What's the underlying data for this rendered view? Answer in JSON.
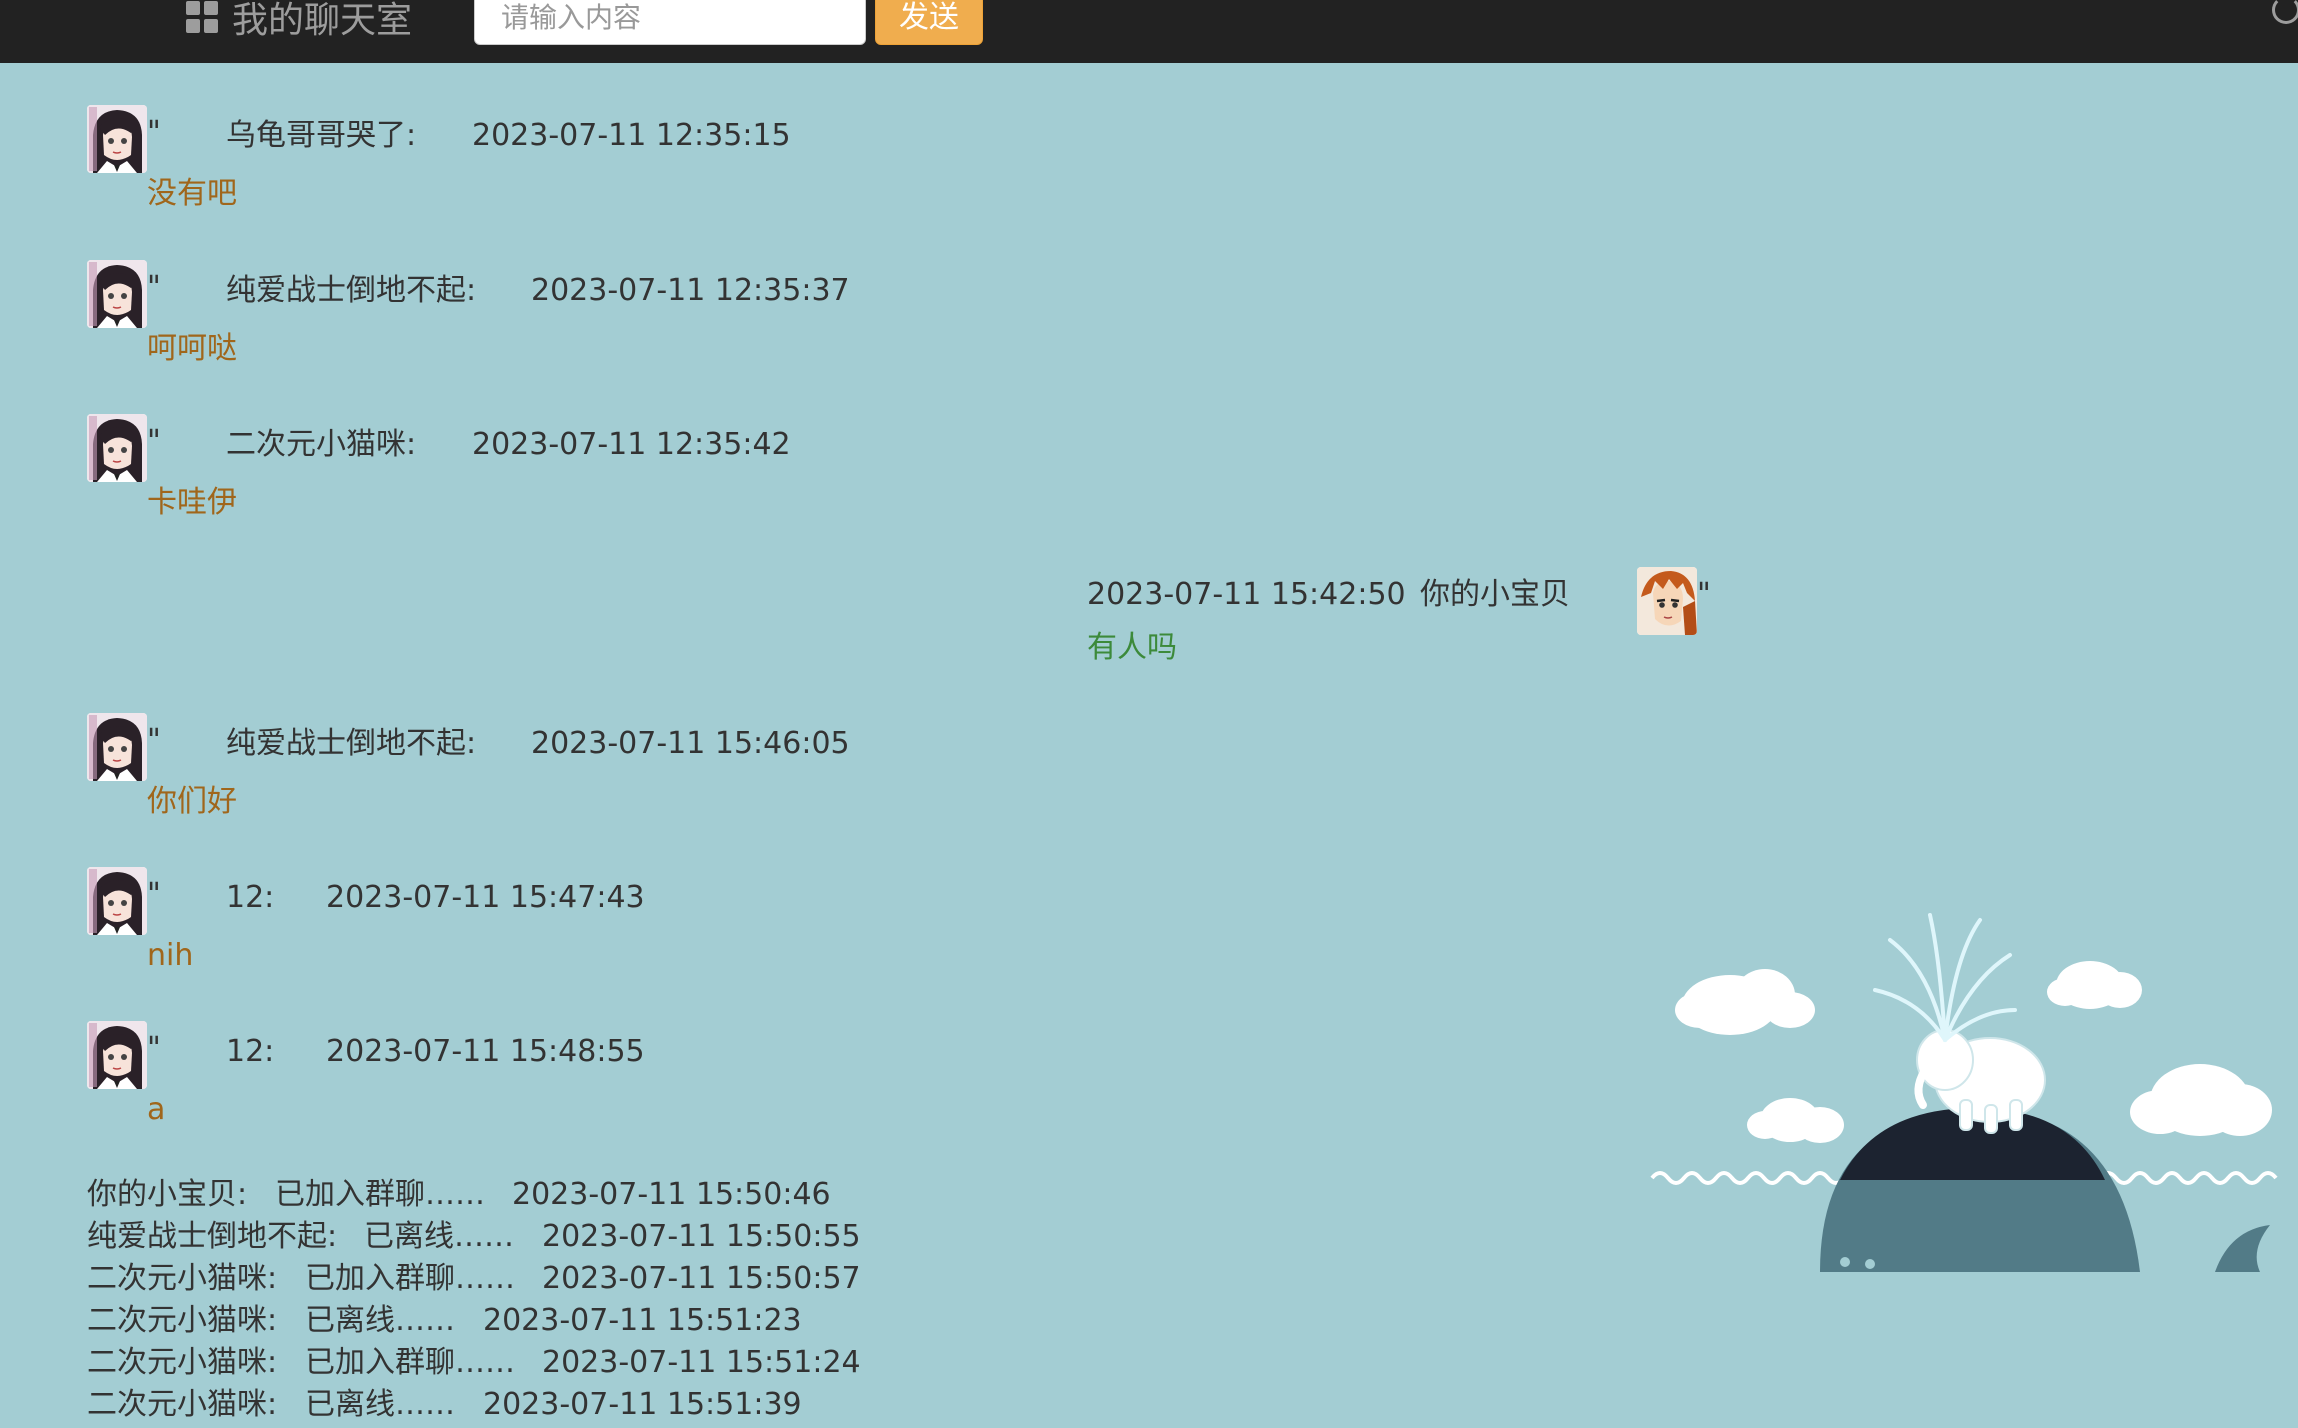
{
  "header": {
    "title": "我的聊天室",
    "input": {
      "placeholder": "请输入内容",
      "value": ""
    },
    "send_label": "发送"
  },
  "messages": [
    {
      "user": "乌龟哥哥哭了:",
      "time": "2023-07-11 12:35:15",
      "text": "没有吧",
      "self": false
    },
    {
      "user": "纯爱战士倒地不起:",
      "time": "2023-07-11 12:35:37",
      "text": "呵呵哒",
      "self": false
    },
    {
      "user": "二次元小猫咪:",
      "time": "2023-07-11 12:35:42",
      "text": "卡哇伊",
      "self": false
    },
    {
      "user": "你的小宝贝",
      "time": "2023-07-11 15:42:50",
      "text": "有人吗",
      "self": true
    },
    {
      "user": "纯爱战士倒地不起:",
      "time": "2023-07-11 15:46:05",
      "text": "你们好",
      "self": false
    },
    {
      "user": "12:",
      "time": "2023-07-11 15:47:43",
      "text": "nih",
      "self": false
    },
    {
      "user": "12:",
      "time": "2023-07-11 15:48:55",
      "text": "a",
      "self": false
    }
  ],
  "avatar_quote": "\"",
  "system_log": [
    {
      "user": "你的小宝贝:",
      "event": "已加入群聊……",
      "time": "2023-07-11 15:50:46"
    },
    {
      "user": "纯爱战士倒地不起:",
      "event": "已离线……",
      "time": "2023-07-11 15:50:55"
    },
    {
      "user": "二次元小猫咪:",
      "event": "已加入群聊……",
      "time": "2023-07-11 15:50:57"
    },
    {
      "user": "二次元小猫咪:",
      "event": "已离线……",
      "time": "2023-07-11 15:51:23"
    },
    {
      "user": "二次元小猫咪:",
      "event": "已加入群聊……",
      "time": "2023-07-11 15:51:24"
    },
    {
      "user": "二次元小猫咪:",
      "event": "已离线……",
      "time": "2023-07-11 15:51:39"
    }
  ],
  "colors": {
    "background": "#a3cdd3",
    "navbar": "#222222",
    "send_button": "#f0ad4e",
    "other_message_text": "#a0661b",
    "self_message_text": "#3c8a3a"
  },
  "icons": [
    "grid-icon",
    "refresh-icon",
    "avatar-girl-icon",
    "avatar-boy-icon",
    "whale-elephant-illustration"
  ]
}
